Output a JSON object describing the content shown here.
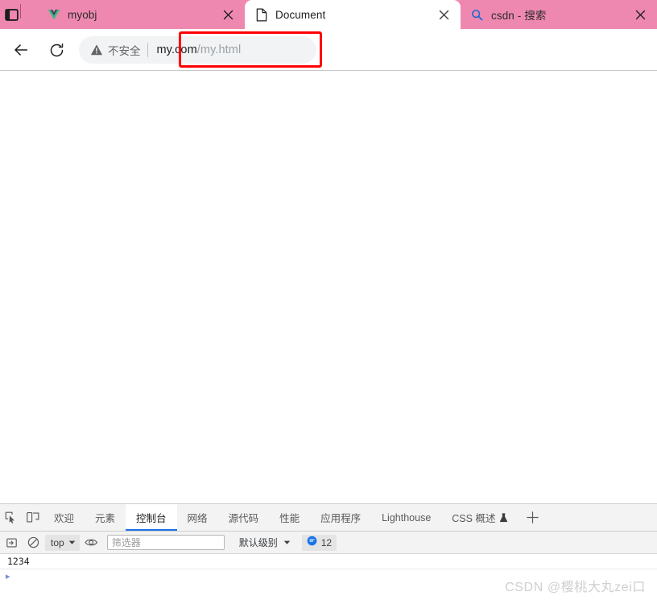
{
  "window": {
    "tab_search_icon": "tab-list-icon"
  },
  "tabs": [
    {
      "title": "myobj",
      "favicon": "vue-logo-icon",
      "active": false,
      "close_icon": "close-icon"
    },
    {
      "title": "Document",
      "favicon": "document-page-icon",
      "active": true,
      "close_icon": "close-icon"
    },
    {
      "title": "csdn - 搜索",
      "favicon": "search-icon",
      "active": false,
      "close_icon": "close-icon"
    }
  ],
  "toolbar": {
    "back_icon": "back-arrow-icon",
    "reload_icon": "reload-icon",
    "security": {
      "icon": "warning-triangle-icon",
      "label": "不安全"
    },
    "url": {
      "host": "my.com",
      "path": "/my.html",
      "full": "my.com/my.html"
    },
    "annotation_color": "#fe0000"
  },
  "page": {
    "content": ""
  },
  "devtools": {
    "inspect_icon": "inspect-element-icon",
    "device_toggle_icon": "device-toolbar-icon",
    "add_panel_icon": "plus-icon",
    "tabs": [
      {
        "label": "欢迎",
        "active": false
      },
      {
        "label": "元素",
        "active": false
      },
      {
        "label": "控制台",
        "active": true
      },
      {
        "label": "网络",
        "active": false
      },
      {
        "label": "源代码",
        "active": false
      },
      {
        "label": "性能",
        "active": false
      },
      {
        "label": "应用程序",
        "active": false
      },
      {
        "label": "Lighthouse",
        "active": false
      },
      {
        "label": "CSS 概述",
        "active": false,
        "beaker_icon": "beaker-icon"
      }
    ],
    "active_tab_accent": "#1a73e8",
    "console_toolbar": {
      "console_sidebar_icon": "console-sidebar-icon",
      "clear_icon": "clear-console-icon",
      "context": "top",
      "context_caret_icon": "chevron-down-icon",
      "live_expression_icon": "eye-icon",
      "filter_placeholder": "筛选器",
      "filter_value": "",
      "level": "默认级别",
      "level_caret_icon": "chevron-down-icon",
      "message_badge_icon": "message-bubble-icon",
      "message_count": "12",
      "badge_color": "#1a73e8"
    },
    "console_output": [
      {
        "text": "1234"
      }
    ]
  },
  "watermark": {
    "text": "CSDN @樱桃大丸zei口"
  }
}
